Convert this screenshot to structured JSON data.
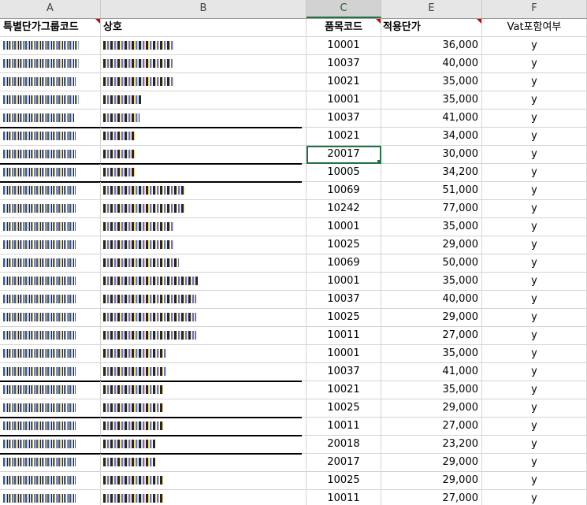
{
  "columns": [
    "A",
    "B",
    "C",
    "E",
    "F"
  ],
  "header": {
    "a": "특별단가그룹코드",
    "b": "상호",
    "c": "품목코드",
    "e": "적용단가",
    "f": "Vat포함여부"
  },
  "rows": [
    {
      "code": "10001",
      "price": "36,000",
      "vat": "y"
    },
    {
      "code": "10037",
      "price": "40,000",
      "vat": "y"
    },
    {
      "code": "10021",
      "price": "35,000",
      "vat": "y"
    },
    {
      "code": "10001",
      "price": "35,000",
      "vat": "y"
    },
    {
      "code": "10037",
      "price": "41,000",
      "vat": "y"
    },
    {
      "code": "10021",
      "price": "34,000",
      "vat": "y"
    },
    {
      "code": "20017",
      "price": "30,000",
      "vat": "y"
    },
    {
      "code": "10005",
      "price": "34,200",
      "vat": "y"
    },
    {
      "code": "10069",
      "price": "51,000",
      "vat": "y"
    },
    {
      "code": "10242",
      "price": "77,000",
      "vat": "y"
    },
    {
      "code": "10001",
      "price": "35,000",
      "vat": "y"
    },
    {
      "code": "10025",
      "price": "29,000",
      "vat": "y"
    },
    {
      "code": "10069",
      "price": "50,000",
      "vat": "y"
    },
    {
      "code": "10001",
      "price": "35,000",
      "vat": "y"
    },
    {
      "code": "10037",
      "price": "40,000",
      "vat": "y"
    },
    {
      "code": "10025",
      "price": "29,000",
      "vat": "y"
    },
    {
      "code": "10011",
      "price": "27,000",
      "vat": "y"
    },
    {
      "code": "10001",
      "price": "35,000",
      "vat": "y"
    },
    {
      "code": "10037",
      "price": "41,000",
      "vat": "y"
    },
    {
      "code": "10021",
      "price": "35,000",
      "vat": "y"
    },
    {
      "code": "10025",
      "price": "29,000",
      "vat": "y"
    },
    {
      "code": "10011",
      "price": "27,000",
      "vat": "y"
    },
    {
      "code": "20018",
      "price": "23,200",
      "vat": "y"
    },
    {
      "code": "20017",
      "price": "29,000",
      "vat": "y"
    },
    {
      "code": "10025",
      "price": "29,000",
      "vat": "y"
    },
    {
      "code": "10011",
      "price": "27,000",
      "vat": "y"
    }
  ]
}
